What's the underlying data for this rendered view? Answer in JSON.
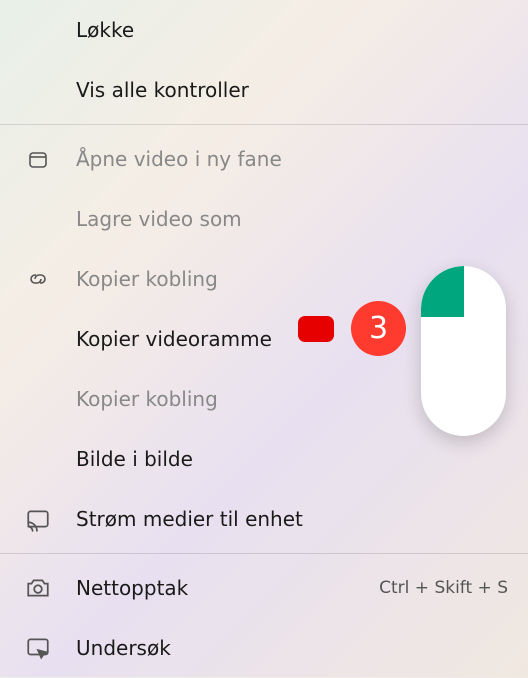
{
  "menu": {
    "group1": {
      "loop": "Løkke",
      "showAll": "Vis alle kontroller"
    },
    "group2": {
      "openNewTab": "Åpne video i ny fane",
      "saveAs": "Lagre video som",
      "copyLink1": "Kopier kobling",
      "copyFrame": "Kopier videoramme",
      "copyLink2": "Kopier kobling",
      "pip": "Bilde i bilde",
      "cast": "Strøm medier til enhet"
    },
    "group3": {
      "webCapture": "Nettopptak",
      "webCaptureShortcut": "Ctrl + Skift + S",
      "inspect": "Undersøk"
    }
  },
  "badge": {
    "number": "3"
  }
}
